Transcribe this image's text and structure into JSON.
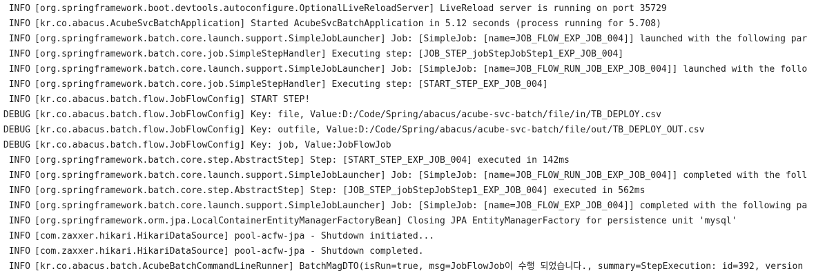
{
  "console": {
    "lines": [
      {
        "level": "INFO",
        "logger": "[org.springframework.boot.devtools.autoconfigure.OptionalLiveReloadServer]",
        "message": " LiveReload server is running on port 35729"
      },
      {
        "level": "INFO",
        "logger": "[kr.co.abacus.AcubeSvcBatchApplication]",
        "message": " Started AcubeSvcBatchApplication in 5.12 seconds (process running for 5.708)"
      },
      {
        "level": "INFO",
        "logger": "[org.springframework.batch.core.launch.support.SimpleJobLauncher]",
        "message": " Job: [SimpleJob: [name=JOB_FLOW_EXP_JOB_004]] launched with the following par"
      },
      {
        "level": "INFO",
        "logger": "[org.springframework.batch.core.job.SimpleStepHandler]",
        "message": " Executing step: [JOB_STEP_jobStepJobStep1_EXP_JOB_004]"
      },
      {
        "level": "INFO",
        "logger": "[org.springframework.batch.core.launch.support.SimpleJobLauncher]",
        "message": " Job: [SimpleJob: [name=JOB_FLOW_RUN_JOB_EXP_JOB_004]] launched with the follo"
      },
      {
        "level": "INFO",
        "logger": "[org.springframework.batch.core.job.SimpleStepHandler]",
        "message": " Executing step: [START_STEP_EXP_JOB_004]"
      },
      {
        "level": "INFO",
        "logger": "[kr.co.abacus.batch.flow.JobFlowConfig]",
        "message": " START STEP!"
      },
      {
        "level": "DEBUG",
        "logger": "[kr.co.abacus.batch.flow.JobFlowConfig]",
        "message": " Key: file, Value:D:/Code/Spring/abacus/acube-svc-batch/file/in/TB_DEPLOY.csv"
      },
      {
        "level": "DEBUG",
        "logger": "[kr.co.abacus.batch.flow.JobFlowConfig]",
        "message": " Key: outfile, Value:D:/Code/Spring/abacus/acube-svc-batch/file/out/TB_DEPLOY_OUT.csv"
      },
      {
        "level": "DEBUG",
        "logger": "[kr.co.abacus.batch.flow.JobFlowConfig]",
        "message": " Key: job, Value:JobFlowJob"
      },
      {
        "level": "INFO",
        "logger": "[org.springframework.batch.core.step.AbstractStep]",
        "message": " Step: [START_STEP_EXP_JOB_004] executed in 142ms"
      },
      {
        "level": "INFO",
        "logger": "[org.springframework.batch.core.launch.support.SimpleJobLauncher]",
        "message": " Job: [SimpleJob: [name=JOB_FLOW_RUN_JOB_EXP_JOB_004]] completed with the foll"
      },
      {
        "level": "INFO",
        "logger": "[org.springframework.batch.core.step.AbstractStep]",
        "message": " Step: [JOB_STEP_jobStepJobStep1_EXP_JOB_004] executed in 562ms"
      },
      {
        "level": "INFO",
        "logger": "[org.springframework.batch.core.launch.support.SimpleJobLauncher]",
        "message": " Job: [SimpleJob: [name=JOB_FLOW_EXP_JOB_004]] completed with the following pa"
      },
      {
        "level": "INFO",
        "logger": "[org.springframework.orm.jpa.LocalContainerEntityManagerFactoryBean]",
        "message": " Closing JPA EntityManagerFactory for persistence unit 'mysql'"
      },
      {
        "level": "INFO",
        "logger": "[com.zaxxer.hikari.HikariDataSource]",
        "message": " pool-acfw-jpa - Shutdown initiated..."
      },
      {
        "level": "INFO",
        "logger": "[com.zaxxer.hikari.HikariDataSource]",
        "message": " pool-acfw-jpa - Shutdown completed."
      },
      {
        "level": "INFO",
        "logger": "[kr.co.abacus.batch.AcubeBatchCommandLineRunner]",
        "message": " BatchMagDTO(isRun=true, msg=JobFlowJob이 수행 되었습니다., summary=StepExecution: id=392, version"
      }
    ]
  }
}
